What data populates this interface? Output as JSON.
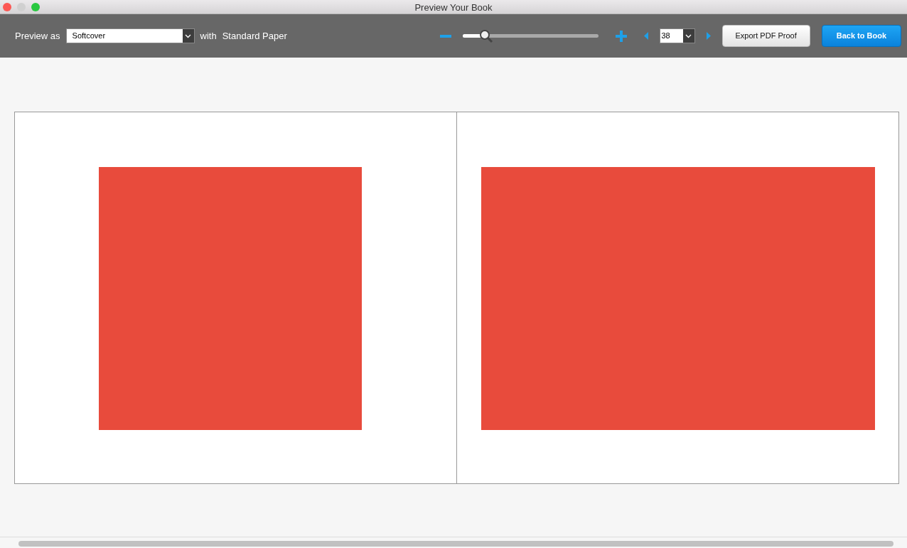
{
  "window": {
    "title": "Preview Your Book"
  },
  "toolbar": {
    "preview_label": "Preview as",
    "format": {
      "value": "Softcover"
    },
    "with_label": "with",
    "paper": "Standard Paper",
    "zoom": {
      "level": 0.16
    },
    "page": {
      "value": "38"
    },
    "buttons": [
      {
        "label": "Export PDF Proof",
        "kind": "secondary"
      },
      {
        "label": "Back to Book",
        "kind": "primary"
      }
    ]
  },
  "spread": {
    "pages": [
      {
        "kind": "square"
      },
      {
        "kind": "wide"
      }
    ]
  }
}
